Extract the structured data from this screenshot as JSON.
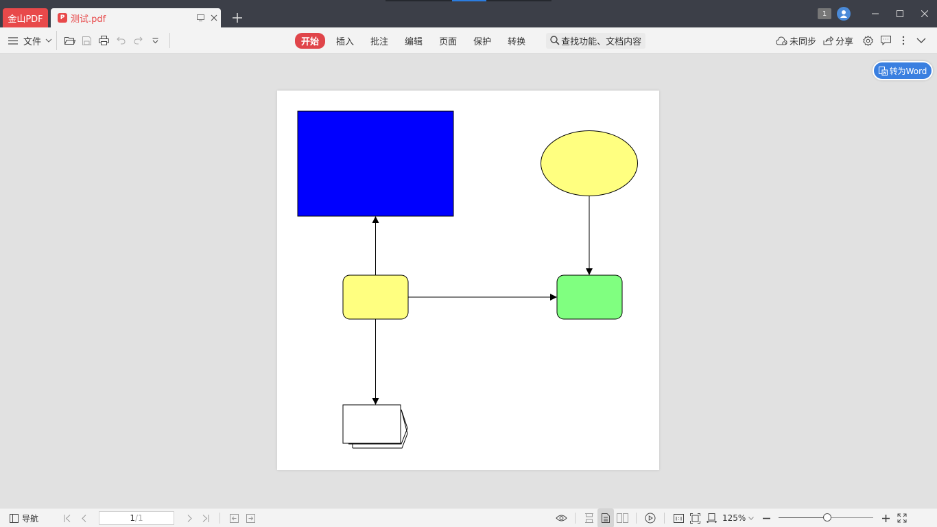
{
  "titlebar": {
    "app_tab": "金山PDF",
    "doc_tab": "测试.pdf",
    "pdf_icon_glyph": "P",
    "window_count": "1"
  },
  "toolbar": {
    "file_menu": "文件",
    "tabs": [
      "开始",
      "插入",
      "批注",
      "编辑",
      "页面",
      "保护",
      "转换"
    ],
    "active_tab": "开始",
    "search_placeholder": "查找功能、文档内容",
    "sync_label": "未同步",
    "share_label": "分享"
  },
  "document": {
    "convert_button": "转为Word",
    "shapes": [
      {
        "kind": "rectangle",
        "fill": "#0000ff"
      },
      {
        "kind": "ellipse",
        "fill": "#ffff80"
      },
      {
        "kind": "rounded-rectangle",
        "fill": "#ffff80"
      },
      {
        "kind": "rounded-rectangle",
        "fill": "#80ff80"
      },
      {
        "kind": "multi-document",
        "fill": "#ffffff"
      }
    ],
    "connectors": [
      {
        "from": "yellow-rounded-box",
        "to": "blue-rectangle"
      },
      {
        "from": "yellow-ellipse",
        "to": "green-rounded-box"
      },
      {
        "from": "yellow-rounded-box",
        "to": "green-rounded-box"
      },
      {
        "from": "yellow-rounded-box",
        "to": "document-stack"
      }
    ]
  },
  "statusbar": {
    "nav_label": "导航",
    "current_page": "1",
    "total_pages": "/1",
    "zoom": "125%",
    "zoom_slider_fraction": 0.51
  },
  "colors": {
    "accent_red": "#e8494a",
    "accent_blue": "#3a7fe0"
  }
}
